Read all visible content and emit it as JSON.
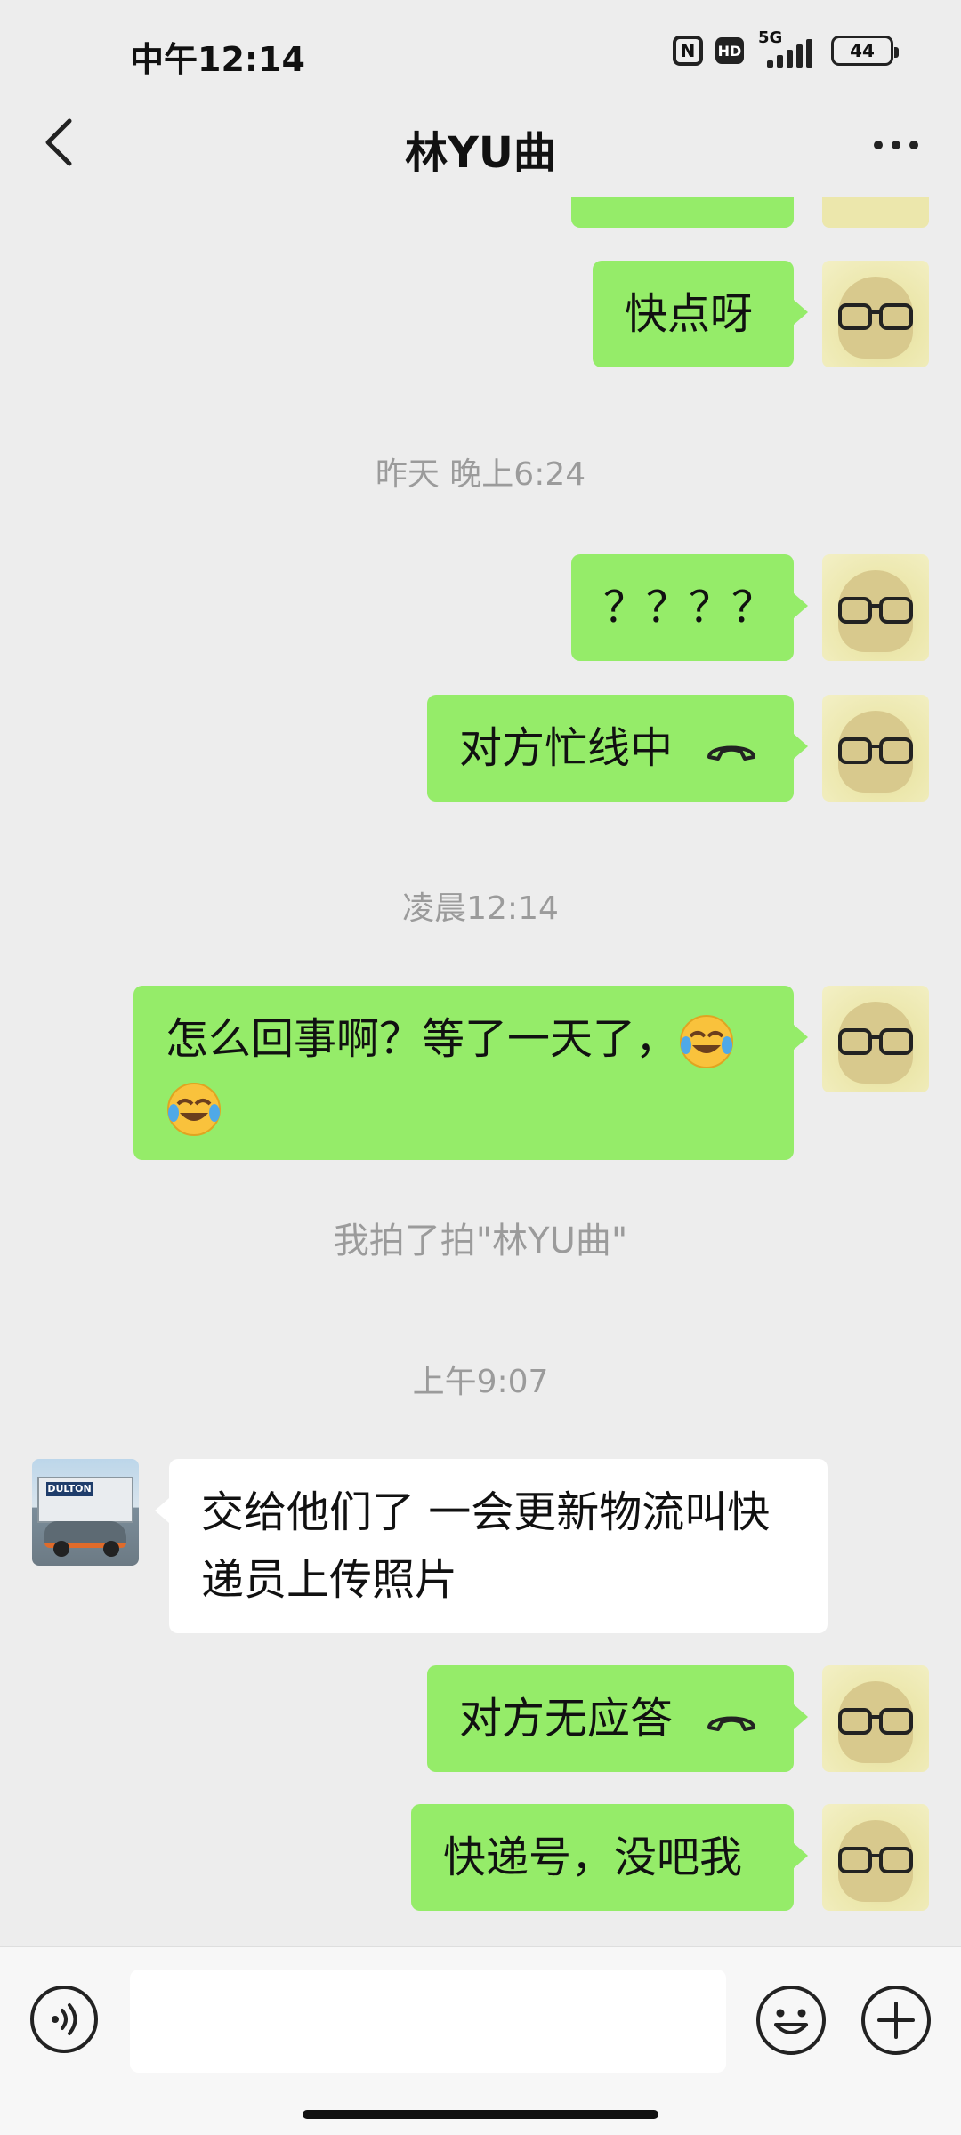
{
  "status_bar": {
    "time": "中午12:14",
    "nfc": "N",
    "hd": "HD",
    "network": "5G",
    "battery": "44"
  },
  "header": {
    "title": "林YU曲"
  },
  "messages": {
    "m1": "快点呀",
    "ts1": "昨天 晚上6:24",
    "m2": "？？？？",
    "m3": "对方忙线中",
    "ts2": "凌晨12:14",
    "m4": "怎么回事啊？等了一天了，",
    "pat": "我拍了拍\"林YU曲\"",
    "ts3": "上午9:07",
    "m5_line1": "交给他们了 一会更新物流叫快",
    "m5_line2": "递员上传照片",
    "m6": "对方无应答",
    "m7": "快递号，没吧我"
  },
  "friend_avatar": {
    "sign_text": "DULTON"
  },
  "colors": {
    "sent_bubble": "#95ec69",
    "received_bubble": "#ffffff",
    "background": "#ededed",
    "timestamp_text": "#9b9b9b"
  },
  "icons": {
    "back": "chevron-left-icon",
    "more": "more-dots-icon",
    "call": "hang-up-icon",
    "voice": "voice-icon",
    "emoji": "emoji-icon",
    "plus": "plus-icon",
    "emoji_in_message": "face-with-tears-of-joy"
  }
}
